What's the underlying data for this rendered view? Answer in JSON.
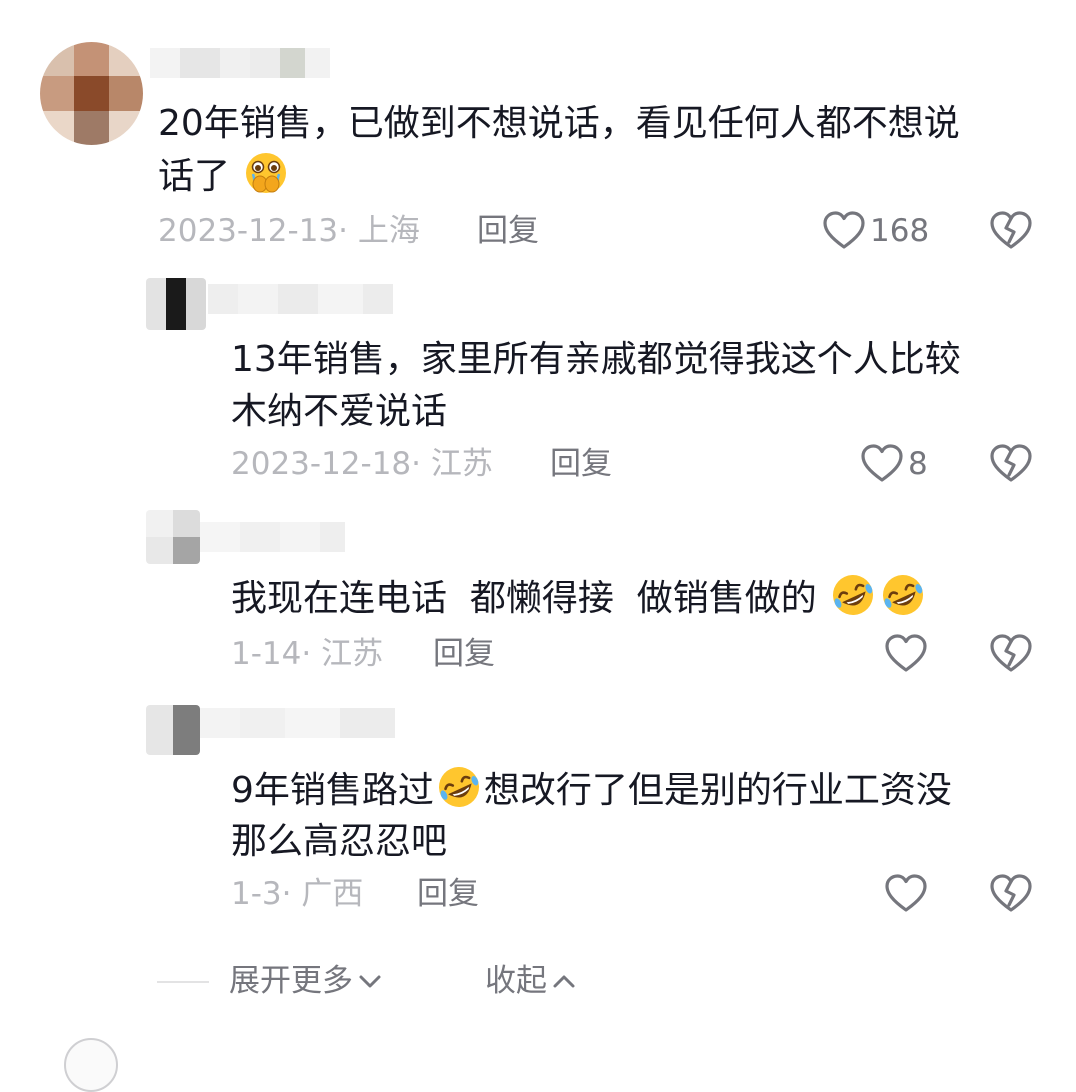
{
  "comments": [
    {
      "text_lines": [
        "20年销售，已做到不想说话，看见任何人都不想说",
        "话了"
      ],
      "emoji": [
        "crying-hands-emoji"
      ],
      "date": "2023-12-13",
      "location": "上海",
      "reply_label": "回复",
      "likes": "168"
    },
    {
      "text_lines": [
        "13年销售，家里所有亲戚都觉得我这个人比较",
        "木纳不爱说话"
      ],
      "date": "2023-12-18",
      "location": "江苏",
      "reply_label": "回复",
      "likes": "8"
    },
    {
      "text_segments": [
        "我现在连电话  都懒得接  做销售做的"
      ],
      "emoji": [
        "rofl-emoji",
        "rofl-emoji"
      ],
      "date": "1-14",
      "location": "江苏",
      "reply_label": "回复",
      "likes": ""
    },
    {
      "text_segments": [
        "9年销售路过",
        "想改行了但是别的行业工资没"
      ],
      "text_line2": "那么高忍忍吧",
      "emoji": [
        "rofl-emoji"
      ],
      "date": "1-3",
      "location": "广西",
      "reply_label": "回复",
      "likes": ""
    }
  ],
  "footer": {
    "expand_label": "展开更多",
    "collapse_label": "收起"
  },
  "colors": {
    "text": "#161823",
    "meta": "#b6b7bc",
    "secondary": "#75767d",
    "emoji": "#ffc62e"
  }
}
